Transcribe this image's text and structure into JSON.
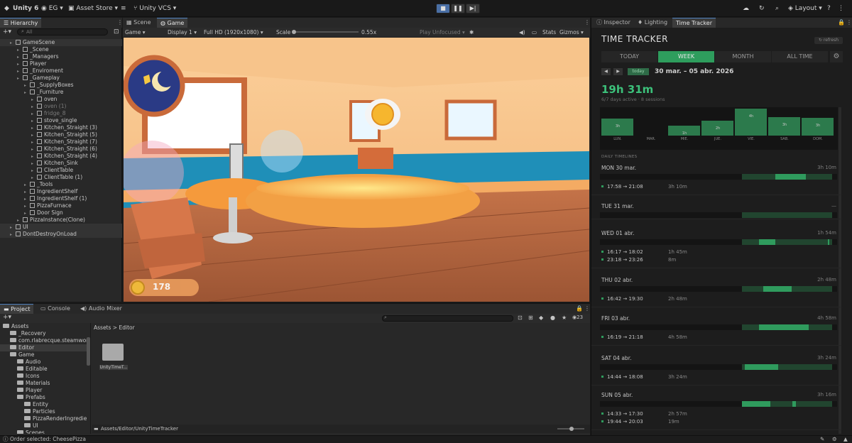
{
  "topbar": {
    "unity_version": "Unity 6",
    "account": "EG",
    "asset_store": "Asset Store",
    "vcs": "Unity VCS",
    "layout": "Layout"
  },
  "hierarchy": {
    "tab": "Hierarchy",
    "search_placeholder": "All",
    "items": [
      {
        "label": "GameScene",
        "depth": 1,
        "scene": true
      },
      {
        "label": "_Scene",
        "depth": 2
      },
      {
        "label": "_Managers",
        "depth": 2
      },
      {
        "label": "Player",
        "depth": 2
      },
      {
        "label": "_Enviroment",
        "depth": 2
      },
      {
        "label": "_Gameplay",
        "depth": 2
      },
      {
        "label": "_SupplyBoxes",
        "depth": 3
      },
      {
        "label": "_Furniture",
        "depth": 3
      },
      {
        "label": "oven",
        "depth": 4
      },
      {
        "label": "oven (1)",
        "depth": 4,
        "dim": true
      },
      {
        "label": "fridge_8",
        "depth": 4,
        "dim": true
      },
      {
        "label": "stove_single",
        "depth": 4
      },
      {
        "label": "Kitchen_Straight (3)",
        "depth": 4
      },
      {
        "label": "Kitchen_Straight (5)",
        "depth": 4
      },
      {
        "label": "Kitchen_Straight (7)",
        "depth": 4
      },
      {
        "label": "Kitchen_Straight (6)",
        "depth": 4
      },
      {
        "label": "Kitchen_Straight (4)",
        "depth": 4
      },
      {
        "label": "Kitchen_Sink",
        "depth": 4
      },
      {
        "label": "ClientTable",
        "depth": 4
      },
      {
        "label": "ClientTable (1)",
        "depth": 4
      },
      {
        "label": "_Tools",
        "depth": 3
      },
      {
        "label": "IngredientShelf",
        "depth": 3
      },
      {
        "label": "IngredientShelf (1)",
        "depth": 3
      },
      {
        "label": "PizzaFurnace",
        "depth": 3
      },
      {
        "label": "Door Sign",
        "depth": 3
      },
      {
        "label": "PizzaInstance(Clone)",
        "depth": 2
      },
      {
        "label": "UI",
        "depth": 1,
        "scene": true
      },
      {
        "label": "DontDestroyOnLoad",
        "depth": 1,
        "scene": true
      }
    ]
  },
  "game_panel": {
    "tabs": [
      "Scene",
      "Game"
    ],
    "active_tab": "Game",
    "view_mode": "Game",
    "display": "Display 1",
    "resolution": "Full HD (1920x1080)",
    "scale_label": "Scale",
    "scale_value": "0.55x",
    "play_mode": "Play Unfocused",
    "stats": "Stats",
    "gizmos": "Gizmos",
    "coins": "178"
  },
  "project": {
    "tabs": [
      "Project",
      "Console",
      "Audio Mixer"
    ],
    "visible_count": "23",
    "breadcrumb": [
      "Assets",
      "Editor"
    ],
    "tree": [
      {
        "label": "Assets",
        "depth": 0
      },
      {
        "label": "_Recovery",
        "depth": 1
      },
      {
        "label": "com.rlabrecque.steamwor",
        "depth": 1
      },
      {
        "label": "Editor",
        "depth": 1,
        "selected": true
      },
      {
        "label": "Game",
        "depth": 1
      },
      {
        "label": "Audio",
        "depth": 2
      },
      {
        "label": "Editable",
        "depth": 2
      },
      {
        "label": "Icons",
        "depth": 2
      },
      {
        "label": "Materials",
        "depth": 2
      },
      {
        "label": "Player",
        "depth": 2
      },
      {
        "label": "Prefabs",
        "depth": 2
      },
      {
        "label": "Entity",
        "depth": 3
      },
      {
        "label": "Particles",
        "depth": 3
      },
      {
        "label": "PizzaRenderIngredie",
        "depth": 3
      },
      {
        "label": "UI",
        "depth": 3
      },
      {
        "label": "Scenes",
        "depth": 2
      }
    ],
    "folder_item": "UnityTimeT...",
    "footer_path": "Assets/Editor/UnityTimeTracker"
  },
  "status": {
    "text": "Order selected: CheesePizza"
  },
  "inspector_tabs": [
    "Inspector",
    "Lighting",
    "Time Tracker"
  ],
  "time_tracker": {
    "title": "TIME TRACKER",
    "refresh": "refresh",
    "ranges": [
      "TODAY",
      "WEEK",
      "MONTH",
      "ALL TIME"
    ],
    "active_range": "WEEK",
    "today_btn": "today",
    "date_range": "30 mar. – 05 abr. 2026",
    "total": "19h 31m",
    "summary": "6/7 days active · 8 sessions",
    "chart_data": {
      "type": "bar",
      "categories": [
        "LUN.",
        "MAR.",
        "MIE.",
        "JUE.",
        "VIE.",
        "SAB.",
        "DOM."
      ],
      "values": [
        3.17,
        0,
        1.9,
        2.8,
        4.97,
        3.4,
        3.3
      ],
      "labels": [
        "3h",
        "",
        "1h",
        "2h",
        "4h",
        "3h",
        "3h"
      ]
    },
    "timelines_label": "DAILY TIMELINES",
    "days": [
      {
        "title": "MON  30 mar.",
        "total": "3h 10m",
        "bars": [
          [
            0.74,
            0.87
          ]
        ],
        "sessions": [
          {
            "time": "17:58 → 21:08",
            "dur": "3h 10m"
          }
        ]
      },
      {
        "title": "TUE  31 mar.",
        "total": "—",
        "bars": [],
        "sessions": []
      },
      {
        "title": "WED  01 abr.",
        "total": "1h 54m",
        "bars": [
          [
            0.67,
            0.74
          ],
          [
            0.96,
            0.965
          ]
        ],
        "sessions": [
          {
            "time": "16:17 → 18:02",
            "dur": "1h 45m"
          },
          {
            "time": "23:18 → 23:26",
            "dur": "8m"
          }
        ]
      },
      {
        "title": "THU  02 abr.",
        "total": "2h 48m",
        "bars": [
          [
            0.69,
            0.81
          ]
        ],
        "sessions": [
          {
            "time": "16:42 → 19:30",
            "dur": "2h 48m"
          }
        ]
      },
      {
        "title": "FRI  03 abr.",
        "total": "4h 58m",
        "bars": [
          [
            0.67,
            0.88
          ]
        ],
        "sessions": [
          {
            "time": "16:19 → 21:18",
            "dur": "4h 58m"
          }
        ]
      },
      {
        "title": "SAT  04 abr.",
        "total": "3h 24m",
        "bars": [
          [
            0.61,
            0.75
          ]
        ],
        "sessions": [
          {
            "time": "14:44 → 18:08",
            "dur": "3h 24m"
          }
        ]
      },
      {
        "title": "SUN  05 abr.",
        "total": "3h 16m",
        "bars": [
          [
            0.6,
            0.72
          ],
          [
            0.81,
            0.825
          ]
        ],
        "sessions": [
          {
            "time": "14:33 → 17:30",
            "dur": "2h 57m"
          },
          {
            "time": "19:44 → 20:03",
            "dur": "19m"
          }
        ]
      }
    ]
  }
}
